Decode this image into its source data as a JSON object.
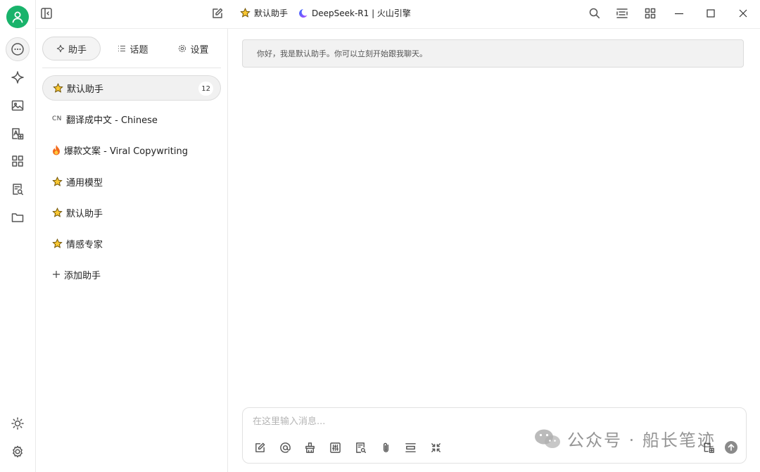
{
  "topbar": {
    "assistant_name": "默认助手",
    "model_name": "DeepSeek-R1 | 火山引擎"
  },
  "panel": {
    "tabs": [
      {
        "label": "助手",
        "icon": "sparkle-icon"
      },
      {
        "label": "话题",
        "icon": "list-icon"
      },
      {
        "label": "设置",
        "icon": "gear-icon"
      }
    ],
    "assistants": [
      {
        "prefix": "star",
        "label": "默认助手",
        "count": "12"
      },
      {
        "prefix": "CN",
        "label": "翻译成中文 - Chinese"
      },
      {
        "prefix": "fire",
        "label": "爆款文案 - Viral Copywriting"
      },
      {
        "prefix": "star",
        "label": "通用模型"
      },
      {
        "prefix": "star",
        "label": "默认助手"
      },
      {
        "prefix": "star",
        "label": "情感专家"
      }
    ],
    "add_label": "添加助手"
  },
  "chat": {
    "greeting": "你好，我是默认助手。你可以立刻开始跟我聊天。",
    "input_placeholder": "在这里输入消息..."
  },
  "watermark": {
    "text": "公众号 · 船长笔迹"
  },
  "colors": {
    "avatar": "#19b36b",
    "accent_dark": "#444444",
    "border": "#e9e9e9"
  }
}
